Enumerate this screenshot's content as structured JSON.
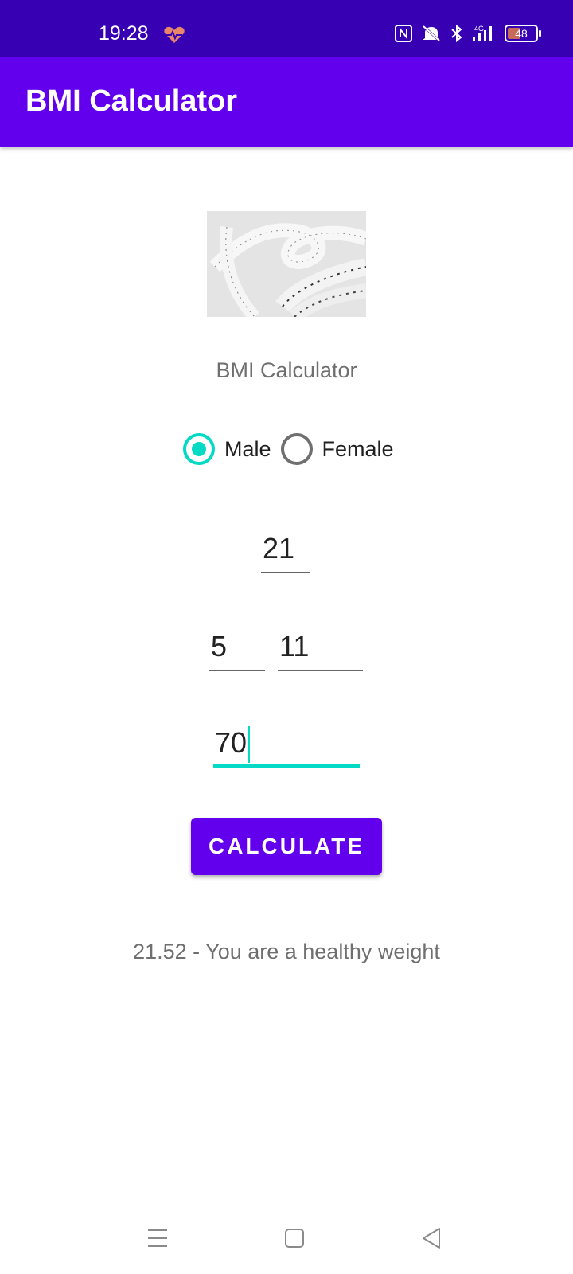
{
  "status_bar": {
    "time": "19:28",
    "battery_level": "48",
    "battery_fraction": 0.48,
    "icons": [
      "heart-rate-icon",
      "nfc-icon",
      "mute-icon",
      "bluetooth-icon",
      "signal-4g-icon",
      "battery-icon"
    ]
  },
  "app_bar": {
    "title": "BMI Calculator"
  },
  "main": {
    "subtitle": "BMI Calculator",
    "gender": {
      "options": [
        {
          "label": "Male",
          "checked": true
        },
        {
          "label": "Female",
          "checked": false
        }
      ]
    },
    "age": "21",
    "height_feet": "5",
    "height_inches": "11",
    "weight": "70",
    "calculate_label": "CALCULATE",
    "result": "21.52 - You are a healthy weight"
  },
  "colors": {
    "status_bar": "#3700b3",
    "app_bar": "#6200ee",
    "accent": "#03dac5",
    "button": "#6200ee"
  }
}
